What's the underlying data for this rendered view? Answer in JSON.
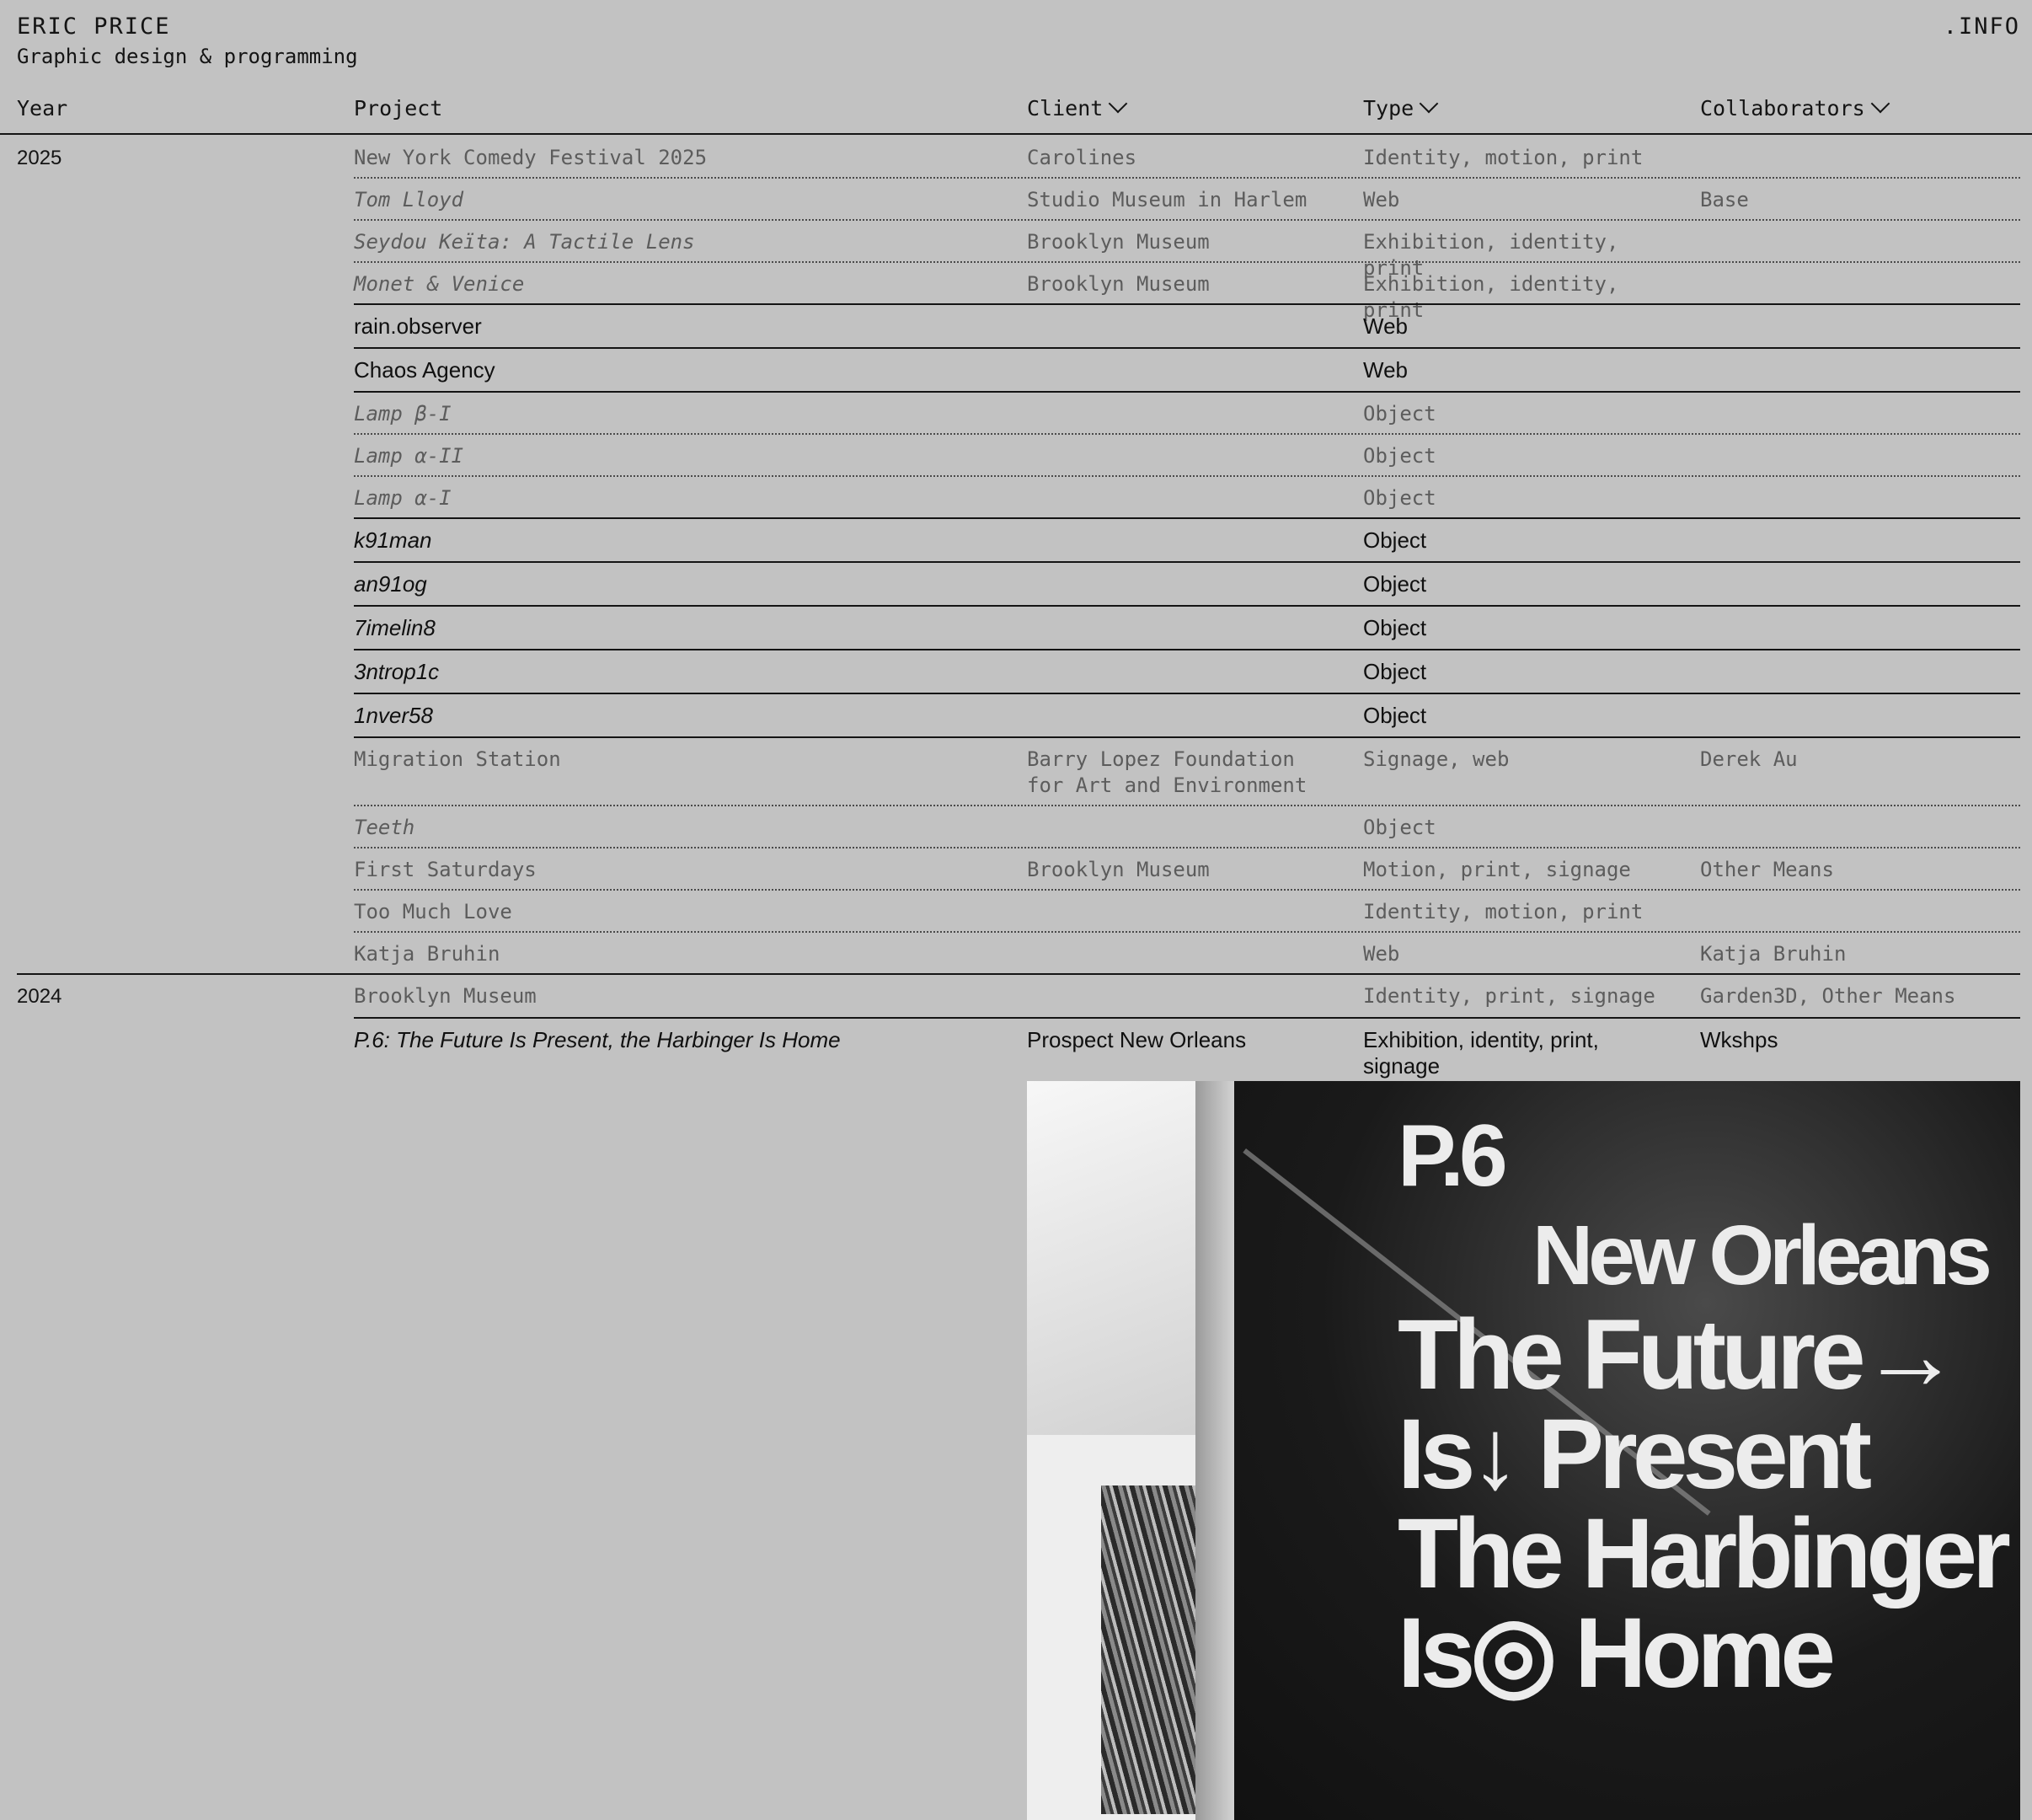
{
  "site": {
    "name": "ERIC PRICE",
    "tagline": "Graphic design & programming",
    "info_link": ".INFO"
  },
  "table": {
    "headers": {
      "year": "Year",
      "project": "Project",
      "client": "Client",
      "type": "Type",
      "collaborators": "Collaborators"
    },
    "years": [
      "2025",
      "2024"
    ],
    "rows": [
      {
        "year": "2025",
        "project": "New York Comedy Festival 2025",
        "client": "Carolines",
        "type": "Identity, motion, print",
        "collaborators": "",
        "style": "gray",
        "italic": false
      },
      {
        "year": "",
        "project": "Tom Lloyd",
        "client": "Studio Museum in Harlem",
        "type": "Web",
        "collaborators": "Base",
        "style": "gray",
        "italic": true
      },
      {
        "year": "",
        "project": "Seydou Keïta: A Tactile Lens",
        "client": "Brooklyn Museum",
        "type": "Exhibition, identity, print",
        "collaborators": "",
        "style": "gray",
        "italic": true
      },
      {
        "year": "",
        "project": "Monet & Venice",
        "client": "Brooklyn Museum",
        "type": "Exhibition, identity, print",
        "collaborators": "",
        "style": "gray",
        "italic": true
      },
      {
        "year": "",
        "project": "rain.observer",
        "client": "",
        "type": "Web",
        "collaborators": "",
        "style": "black",
        "italic": false
      },
      {
        "year": "",
        "project": "Chaos Agency",
        "client": "",
        "type": "Web",
        "collaborators": "",
        "style": "black",
        "italic": false
      },
      {
        "year": "",
        "project": "Lamp β-I",
        "client": "",
        "type": "Object",
        "collaborators": "",
        "style": "gray",
        "italic": true
      },
      {
        "year": "",
        "project": "Lamp α-II",
        "client": "",
        "type": "Object",
        "collaborators": "",
        "style": "gray",
        "italic": true
      },
      {
        "year": "",
        "project": "Lamp α-I",
        "client": "",
        "type": "Object",
        "collaborators": "",
        "style": "gray",
        "italic": true
      },
      {
        "year": "",
        "project": "k91man",
        "client": "",
        "type": "Object",
        "collaborators": "",
        "style": "black",
        "italic": true
      },
      {
        "year": "",
        "project": "an91og",
        "client": "",
        "type": "Object",
        "collaborators": "",
        "style": "black",
        "italic": true
      },
      {
        "year": "",
        "project": "7imelin8",
        "client": "",
        "type": "Object",
        "collaborators": "",
        "style": "black",
        "italic": true
      },
      {
        "year": "",
        "project": "3ntrop1c",
        "client": "",
        "type": "Object",
        "collaborators": "",
        "style": "black",
        "italic": true
      },
      {
        "year": "",
        "project": "1nver58",
        "client": "",
        "type": "Object",
        "collaborators": "",
        "style": "black",
        "italic": true
      },
      {
        "year": "",
        "project": "Migration Station",
        "client": "Barry Lopez Foundation for Art and Environment",
        "type": "Signage, web",
        "collaborators": "Derek Au",
        "style": "gray",
        "italic": false
      },
      {
        "year": "",
        "project": "Teeth",
        "client": "",
        "type": "Object",
        "collaborators": "",
        "style": "gray",
        "italic": true
      },
      {
        "year": "",
        "project": "First Saturdays",
        "client": "Brooklyn Museum",
        "type": "Motion, print, signage",
        "collaborators": "Other Means",
        "style": "gray",
        "italic": false
      },
      {
        "year": "",
        "project": "Too Much Love",
        "client": "",
        "type": "Identity, motion, print",
        "collaborators": "",
        "style": "gray",
        "italic": false
      },
      {
        "year": "",
        "project": "Katja Bruhin",
        "client": "",
        "type": "Web",
        "collaborators": "Katja Bruhin",
        "style": "gray",
        "italic": false
      },
      {
        "year": "2024",
        "project": "Brooklyn Museum",
        "client": "",
        "type": "Identity, print, signage",
        "collaborators": "Garden3D, Other Means",
        "style": "gray",
        "italic": false
      },
      {
        "year": "",
        "project": "P.6: The Future Is Present, the Harbinger Is Home",
        "client": "Prospect New Orleans",
        "type": "Exhibition, identity, print, signage",
        "collaborators": "Wkshps",
        "style": "black",
        "italic": true
      }
    ]
  },
  "hero_image": {
    "sign_lines": [
      "P.6",
      "New Orleans",
      "The Future→",
      "Is↓ Present",
      "The Harbinger ◁",
      "Is◎ Home"
    ]
  }
}
